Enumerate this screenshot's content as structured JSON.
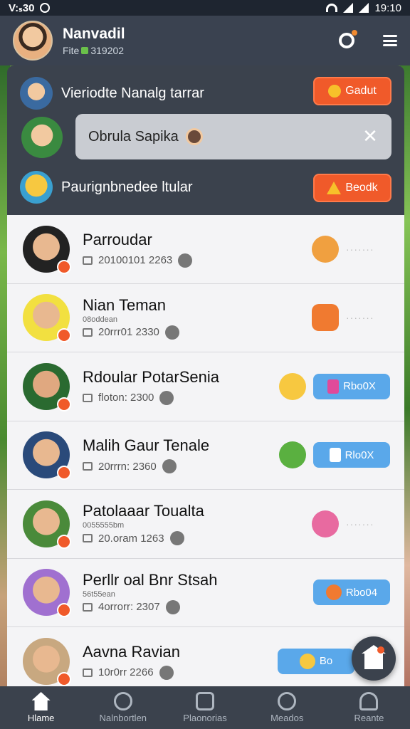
{
  "status_bar": {
    "time": "V:ₛ30",
    "clock": "19:10"
  },
  "header": {
    "title": "Nanvadil",
    "subtitle_prefix": "Fite",
    "subtitle_value": "319202"
  },
  "top_panel": {
    "row1": {
      "text": "Vieriodte Nanalg tarrar",
      "button": "Gadut"
    },
    "search": {
      "value": "Obrula Sapika"
    },
    "row3": {
      "text": "Paurignbnedee ltular",
      "button": "Beodk"
    }
  },
  "list": [
    {
      "name": "Parroudar",
      "small": "",
      "meta": "20100101 2263",
      "right": "dots",
      "button": ""
    },
    {
      "name": "Nian Teman",
      "small": "08oddean",
      "meta": "20rrr01 2330",
      "right": "dots",
      "button": ""
    },
    {
      "name": "Rdoular PotarSenia",
      "small": "",
      "meta": "floton: 2300",
      "right": "button",
      "button": "Rbo0X"
    },
    {
      "name": "Malih Gaur Tenale",
      "small": "",
      "meta": "20rrrn: 2360",
      "right": "button",
      "button": "Rlo0X"
    },
    {
      "name": "Patolaaar Toualta",
      "small": "0055555bm",
      "meta": "20.oram 1263",
      "right": "dots",
      "button": ""
    },
    {
      "name": "Perllr oal Bnr Stsah",
      "small": "56t55ean",
      "meta": "4orrorr: 2307",
      "right": "button",
      "button": "Rbo04"
    },
    {
      "name": "Aavna Ravian",
      "small": "",
      "meta": "10r0rr 2266",
      "right": "button",
      "button": "Bo"
    }
  ],
  "nav": [
    {
      "label": "Hlame",
      "icon": "home-icon"
    },
    {
      "label": "Nalnbortlen",
      "icon": "chat-icon"
    },
    {
      "label": "Plaonorias",
      "icon": "bag-icon"
    },
    {
      "label": "Meados",
      "icon": "message-icon"
    },
    {
      "label": "Reante",
      "icon": "user-icon"
    }
  ],
  "colors": {
    "accent_orange": "#f05a2a",
    "accent_blue": "#5aa8ea",
    "header_bg": "#3a4250",
    "panel_bg": "#3b424d"
  }
}
